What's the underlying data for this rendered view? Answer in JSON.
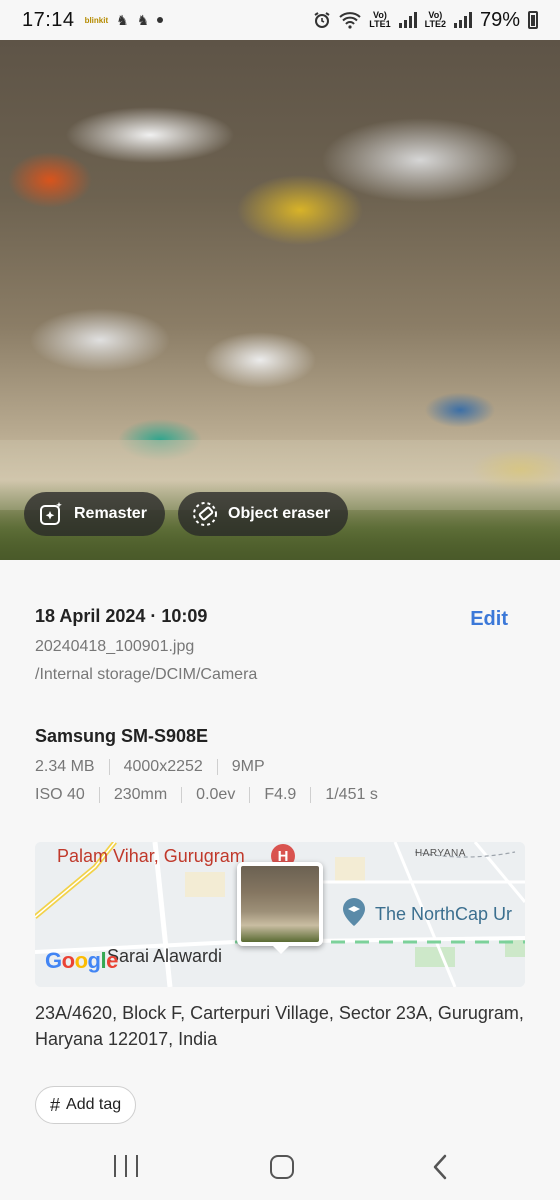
{
  "status_bar": {
    "time": "17:14",
    "notif_app": "blinkit",
    "lte1": "LTE1",
    "lte2": "LTE2",
    "battery": "79%"
  },
  "photo_actions": {
    "remaster_label": "Remaster",
    "eraser_label": "Object eraser"
  },
  "details": {
    "datetime": "18 April 2024 · 10:09",
    "edit_label": "Edit",
    "filename": "20240418_100901.jpg",
    "path": "/Internal storage/DCIM/Camera",
    "device": "Samsung SM-S908E",
    "size": "2.34 MB",
    "resolution": "4000x2252",
    "megapixels": "9MP",
    "iso": "ISO 40",
    "focal": "230mm",
    "ev": "0.0ev",
    "aperture": "F4.9",
    "shutter": "1/451 s"
  },
  "map": {
    "place1": "Palam Vihar, Gurugram",
    "hospital_glyph": "H",
    "region": "HARYANA",
    "place2": "The NorthCap Ur",
    "place3": "Sarai Alawardi",
    "google_letters": [
      "G",
      "o",
      "o",
      "g",
      "l",
      "e"
    ]
  },
  "address": "23A/4620, Block F, Carterpuri Village, Sector 23A, Gurugram, Haryana 122017, India",
  "tag": {
    "hash": "#",
    "label": "Add tag"
  },
  "colors": {
    "accent": "#3b78d8",
    "place_red": "#c0392b"
  }
}
